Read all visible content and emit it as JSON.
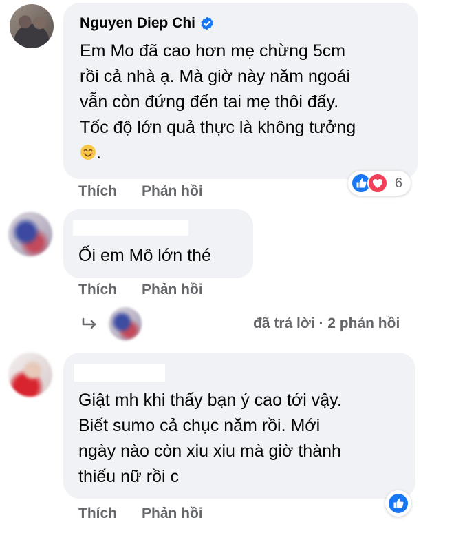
{
  "comments": [
    {
      "author": "Nguyen Diep Chi",
      "verified": true,
      "text": "Em Mo đã cao hơn mẹ chừng 5cm\nrồi cả nhà ạ. Mà giờ này năm ngoái\nvẫn còn đứng đến tai mẹ thôi đấy.\nTốc độ lớn quả thực là không tưởng",
      "text_after_emoji": ".",
      "emoji": "smiling-face-icon",
      "reactions": {
        "icons": [
          "like-icon",
          "love-icon"
        ],
        "count": "6"
      },
      "like_label": "Thích",
      "reply_label": "Phản hồi"
    },
    {
      "author_redacted": true,
      "text": "Ối em Mô lớn thé",
      "like_label": "Thích",
      "reply_label": "Phản hồi",
      "replies_summary": "đã trả lời · 2 phản hồi"
    },
    {
      "author_redacted": true,
      "text": "Giật mh khi thấy bạn ý cao tới vậy.\nBiết sumo cả chục năm rồi. Mới\nngày nào còn xiu xiu mà giờ thành\nthiếu nữ rồi c",
      "reactions": {
        "icons": [
          "like-icon"
        ]
      },
      "like_label": "Thích",
      "reply_label": "Phản hồi"
    }
  ],
  "colors": {
    "bubble": "#f0f2f5",
    "meta_text": "#65676b",
    "like_blue": "#1877f2",
    "love_red": "#f33e58"
  }
}
